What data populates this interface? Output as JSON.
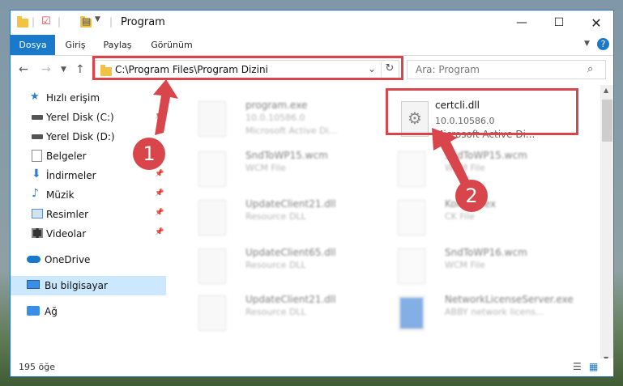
{
  "window": {
    "title": "Program",
    "ribbon_tabs": [
      "Dosya",
      "Giriş",
      "Paylaş",
      "Görünüm"
    ]
  },
  "address": {
    "path": "C:\\Program Files\\Program Dizini",
    "search_placeholder": "Ara: Program"
  },
  "sidebar": {
    "items": [
      {
        "label": "Hızlı erişim",
        "icon": "star-icon"
      },
      {
        "label": "Yerel Disk (C:)",
        "icon": "drive-icon"
      },
      {
        "label": "Yerel Disk (D:)",
        "icon": "drive-icon"
      },
      {
        "label": "Belgeler",
        "icon": "documents-icon"
      },
      {
        "label": "İndirmeler",
        "icon": "download-icon"
      },
      {
        "label": "Müzik",
        "icon": "music-icon"
      },
      {
        "label": "Resimler",
        "icon": "pictures-icon"
      },
      {
        "label": "Videolar",
        "icon": "videos-icon"
      },
      {
        "label": "OneDrive",
        "icon": "cloud-icon"
      },
      {
        "label": "Bu bilgisayar",
        "icon": "computer-icon"
      },
      {
        "label": "Ağ",
        "icon": "network-icon"
      }
    ]
  },
  "files": [
    {
      "name": "program.exe",
      "line2": "10.0.10586.0",
      "line3": "Microsoft Active Di..."
    },
    {
      "name": "certcli.dll",
      "line2": "10.0.10586.0",
      "line3": "Microsoft Active Di..."
    },
    {
      "name": "SndToWP15.wcm",
      "line2": "WCM File",
      "line3": ""
    },
    {
      "name": "SndToWP15.wcm",
      "line2": "WCM File",
      "line3": ""
    },
    {
      "name": "UpdateClient21.dll",
      "line2": "Resource DLL",
      "line3": ""
    },
    {
      "name": "Korean.lex",
      "line2": "CK File",
      "line3": ""
    },
    {
      "name": "UpdateClient65.dll",
      "line2": "Resource DLL",
      "line3": ""
    },
    {
      "name": "SndToWP16.wcm",
      "line2": "WCM File",
      "line3": ""
    },
    {
      "name": "UpdateClient21.dll",
      "line2": "Resource DLL",
      "line3": ""
    },
    {
      "name": "NetworkLicenseServer.exe",
      "line2": "ABBY network licens...",
      "line3": ""
    }
  ],
  "status": {
    "count": "195 öğe"
  },
  "annotations": {
    "badge1": "1",
    "badge2": "2"
  },
  "colors": {
    "accent": "#1979ca",
    "highlight": "#d8454b",
    "selected": "#cce8ff"
  }
}
